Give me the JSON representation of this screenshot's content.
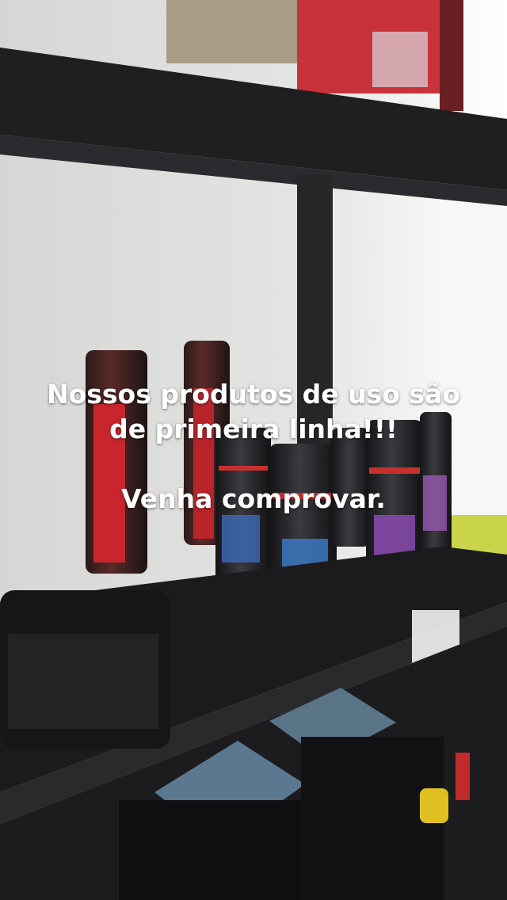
{
  "caption": {
    "line1": "Nossos produtos de uso são",
    "line2": "de primeira linha!!!",
    "line3": "Venha comprovar."
  },
  "colors": {
    "wall": "#dcdcda",
    "shelf": "#1c1c1e",
    "caption_text": "#ffffff"
  }
}
